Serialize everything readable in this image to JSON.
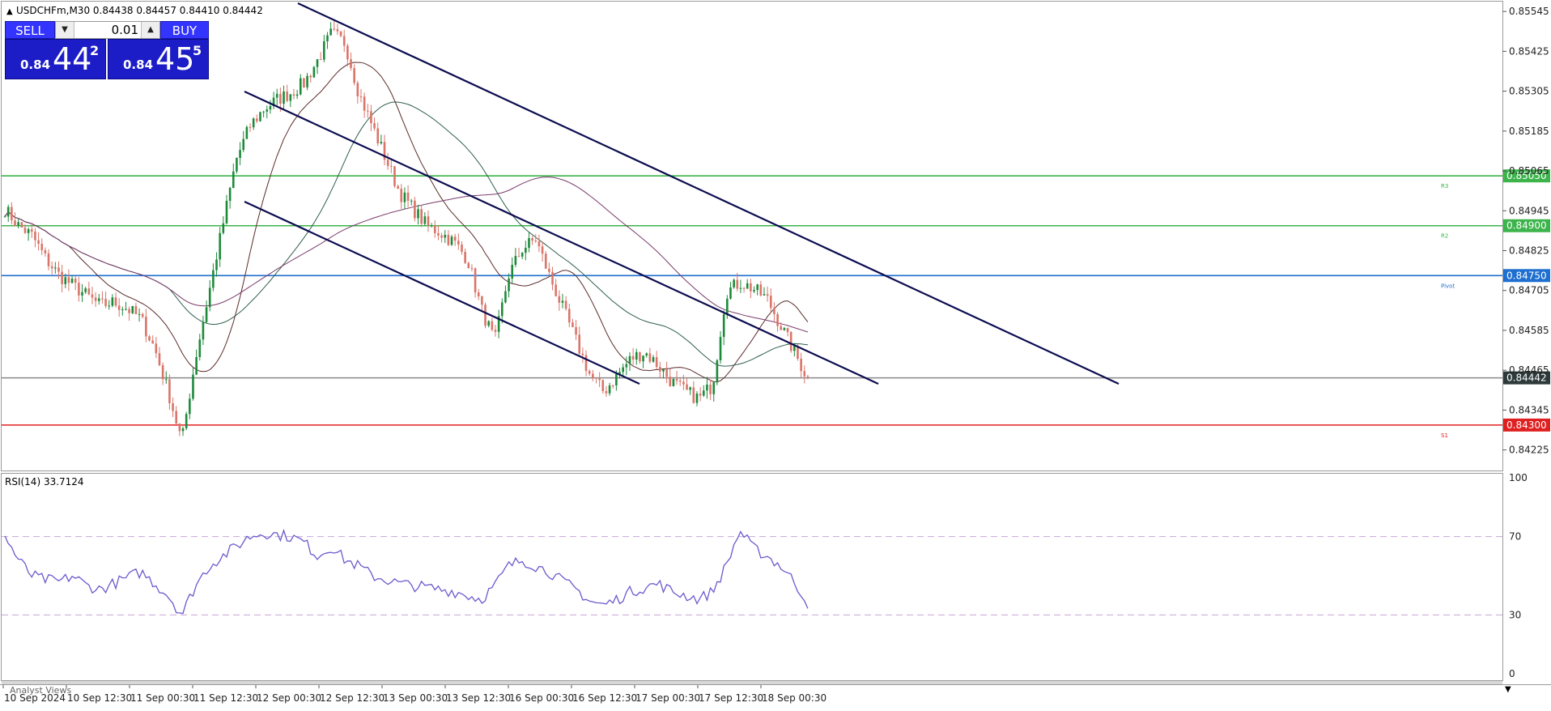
{
  "header": {
    "triangle_icon": "triangle-up-icon",
    "text": "USDCHFm,M30  0.84438 0.84457 0.84410 0.84442"
  },
  "trade_panel": {
    "sell_label": "SELL",
    "buy_label": "BUY",
    "lot_value": "0.01",
    "sell_small": "0.84",
    "sell_big": "44",
    "sell_sup": "2",
    "buy_small": "0.84",
    "buy_big": "45",
    "buy_sup": "5",
    "colors": {
      "button": "#3434ff",
      "price": "#1d1dc8"
    }
  },
  "price_axis": {
    "ticks": [
      "0.85545",
      "0.85425",
      "0.85305",
      "0.85185",
      "0.85065",
      "0.84945",
      "0.84825",
      "0.84705",
      "0.84585",
      "0.84465",
      "0.84345",
      "0.84225"
    ]
  },
  "levels": [
    {
      "label": "R3",
      "price_label": "0.85050",
      "color": "#3cb44b"
    },
    {
      "label": "R2",
      "price_label": "0.84900",
      "color": "#3cb44b"
    },
    {
      "label": "Pivot",
      "price_label": "0.84750",
      "color": "#1e6fd0"
    },
    {
      "label": "",
      "price_label": "0.84442",
      "color": "#888888",
      "tag_bg": "#2e3a3a"
    },
    {
      "label": "S1",
      "price_label": "0.84300",
      "color": "#e02020"
    }
  ],
  "rsi": {
    "title": "RSI(14) 33.7124",
    "ticks": [
      "100",
      "70",
      "30",
      "0"
    ],
    "line_color": "#6a5acd"
  },
  "time_axis": {
    "labels": [
      "10 Sep 2024",
      "10 Sep 12:30",
      "11 Sep 00:30",
      "11 Sep 12:30",
      "12 Sep 00:30",
      "12 Sep 12:30",
      "13 Sep 00:30",
      "13 Sep 12:30",
      "16 Sep 00:30",
      "16 Sep 12:30",
      "17 Sep 00:30",
      "17 Sep 12:30",
      "18 Sep 00:30"
    ]
  },
  "bottom_tab": {
    "label": "Analyst Views"
  },
  "chart_data": {
    "type": "candlestick",
    "symbol": "USDCHFm",
    "timeframe": "M30",
    "ylim": [
      0.8419,
      0.8556
    ],
    "closes_sampled": [
      0.8495,
      0.849,
      0.8487,
      0.848,
      0.8475,
      0.8472,
      0.8469,
      0.8466,
      0.8467,
      0.8465,
      0.8462,
      0.8453,
      0.844,
      0.8425,
      0.845,
      0.847,
      0.849,
      0.851,
      0.852,
      0.8525,
      0.8528,
      0.853,
      0.8533,
      0.854,
      0.8548,
      0.8545,
      0.853,
      0.852,
      0.851,
      0.85,
      0.8495,
      0.849,
      0.8488,
      0.8485,
      0.848,
      0.8465,
      0.8455,
      0.8475,
      0.8483,
      0.8486,
      0.8475,
      0.8465,
      0.8455,
      0.8445,
      0.844,
      0.8445,
      0.845,
      0.8452,
      0.8448,
      0.8443,
      0.844,
      0.8438,
      0.8442,
      0.847,
      0.8473,
      0.8471,
      0.8468,
      0.846,
      0.8452,
      0.8444
    ],
    "rsi_values": [
      70,
      58,
      50,
      48,
      47,
      50,
      45,
      43,
      46,
      49,
      52,
      46,
      40,
      30,
      45,
      55,
      60,
      65,
      70,
      72,
      71,
      70,
      67,
      60,
      65,
      58,
      55,
      50,
      48,
      46,
      45,
      44,
      43,
      42,
      40,
      38,
      45,
      55,
      58,
      55,
      52,
      47,
      43,
      37,
      35,
      38,
      42,
      44,
      46,
      42,
      40,
      38,
      42,
      55,
      73,
      64,
      60,
      55,
      47,
      36
    ],
    "rsi_levels": [
      70,
      30
    ]
  }
}
